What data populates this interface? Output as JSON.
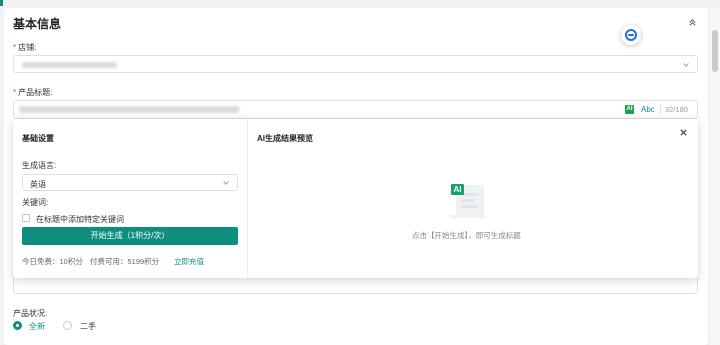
{
  "section": {
    "title": "基本信息"
  },
  "store": {
    "label": "店铺:",
    "required_mark": "*"
  },
  "product_title": {
    "label": "产品标题:",
    "required_mark": "*",
    "ai_badge": "AI",
    "abc": "Abc",
    "count": "32/180"
  },
  "ai_popup": {
    "settings_title": "基础设置",
    "language_label": "生成语言:",
    "language_value": "英语",
    "keywords_label": "关键词:",
    "add_keywords_label": "在标题中添加特定关键词",
    "generate_button": "开始生成（1积分/次）",
    "free_today": "今日免费：10积分",
    "paid_available": "付费可用：5199积分",
    "recharge_link": "立即充值",
    "preview_title": "AI生成结果预览",
    "illustration_badge": "AI",
    "preview_placeholder": "点击【开始生成】，即可生成标题"
  },
  "condition": {
    "label": "产品状况:",
    "options": [
      {
        "label": "全新",
        "selected": true
      },
      {
        "label": "二手",
        "selected": false
      }
    ]
  },
  "colors": {
    "accent": "#0e8f7e",
    "required": "#e54545",
    "ai_badge": "#17a34a"
  },
  "icons": [
    "collapse-chevron-up-icon",
    "chevron-down-icon",
    "close-icon",
    "ai-assistant-icon"
  ]
}
